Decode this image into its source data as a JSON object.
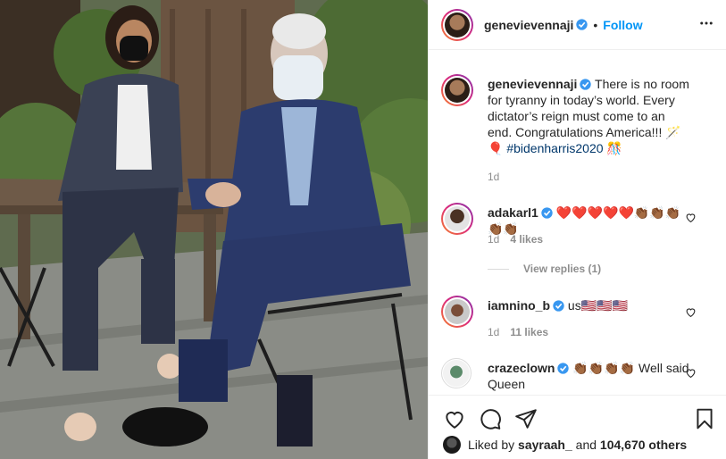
{
  "post": {
    "author": "genevievennaji",
    "follow_label": "Follow",
    "separator": "•",
    "caption": "There is no room for tyranny in today’s world. Every dictator’s reign must come to an end. Congratulations America!!! 🪄🎈",
    "hashtag": "#bidenharris2020",
    "hashtag_suffix": "🎊",
    "age": "1d"
  },
  "comments": [
    {
      "user": "adakarl1",
      "verified": true,
      "text": "❤️❤️❤️❤️❤️👏🏾👏🏾👏🏾👏🏾👏🏾",
      "age": "1d",
      "likes": "4 likes",
      "view_replies": "View replies (1)"
    },
    {
      "user": "iamnino_b",
      "verified": true,
      "text": "us🇺🇸🇺🇸🇺🇸",
      "age": "1d",
      "likes": "11 likes"
    },
    {
      "user": "crazeclown",
      "verified": true,
      "text": "👏🏾👏🏾👏🏾👏🏾 Well said Queen"
    }
  ],
  "likes_summary": {
    "prefix": "Liked by",
    "user": "sayraah_",
    "middle": "and",
    "count": "104,670 others"
  },
  "icons": {
    "verified": "verified-badge-icon",
    "more": "more-options-icon",
    "like": "heart-icon",
    "comment": "comment-icon",
    "share": "share-icon",
    "save": "bookmark-icon"
  },
  "colors": {
    "accent": "#0095f6",
    "verified": "#3897f0",
    "heart_red": "#ed4956"
  }
}
